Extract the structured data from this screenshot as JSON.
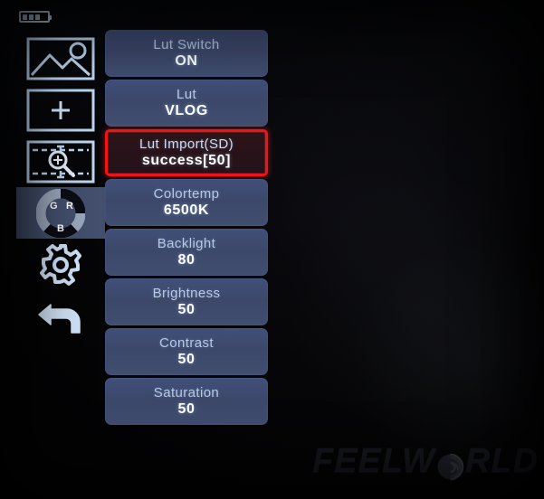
{
  "device": {
    "brand_text_left": "FEELW",
    "brand_text_right": "RLD",
    "brand_logo_icon": "feelworld-swirl-icon"
  },
  "status_bar": {
    "battery_icon": "battery-icon",
    "battery_level_bars": 3
  },
  "sidebar": {
    "items": [
      {
        "name": "image-settings",
        "icon": "picture-mountain-icon",
        "active": false
      },
      {
        "name": "marker-center",
        "icon": "center-crosshair-icon",
        "active": false
      },
      {
        "name": "zoom-scale",
        "icon": "magnifier-scale-icon",
        "active": false
      },
      {
        "name": "color-settings",
        "icon": "rgb-color-wheel-icon",
        "active": true,
        "wheel_labels": [
          "G",
          "R",
          "B"
        ]
      },
      {
        "name": "system-settings",
        "icon": "gear-icon",
        "active": false
      },
      {
        "name": "back",
        "icon": "back-arrow-icon",
        "active": false
      }
    ]
  },
  "menu": {
    "items": [
      {
        "label": "Lut Switch",
        "value": "ON",
        "selected": false
      },
      {
        "label": "Lut",
        "value": "VLOG",
        "selected": false
      },
      {
        "label": "Lut Import(SD)",
        "value": "success[50]",
        "selected": true
      },
      {
        "label": "Colortemp",
        "value": "6500K",
        "selected": false
      },
      {
        "label": "Backlight",
        "value": "80",
        "selected": false
      },
      {
        "label": "Brightness",
        "value": "50",
        "selected": false
      },
      {
        "label": "Contrast",
        "value": "50",
        "selected": false
      },
      {
        "label": "Saturation",
        "value": "50",
        "selected": false
      }
    ]
  },
  "colors": {
    "menu_item_bg": "#3e4a6e",
    "selection_border": "#f01414",
    "selection_bg": "#29131a",
    "label_text": "#b9c9e2",
    "value_text": "#ffffff",
    "icon_stroke": "#bcd6ef",
    "sidebar_active_bg": "#434f6d",
    "screen_bg": "#050507"
  }
}
